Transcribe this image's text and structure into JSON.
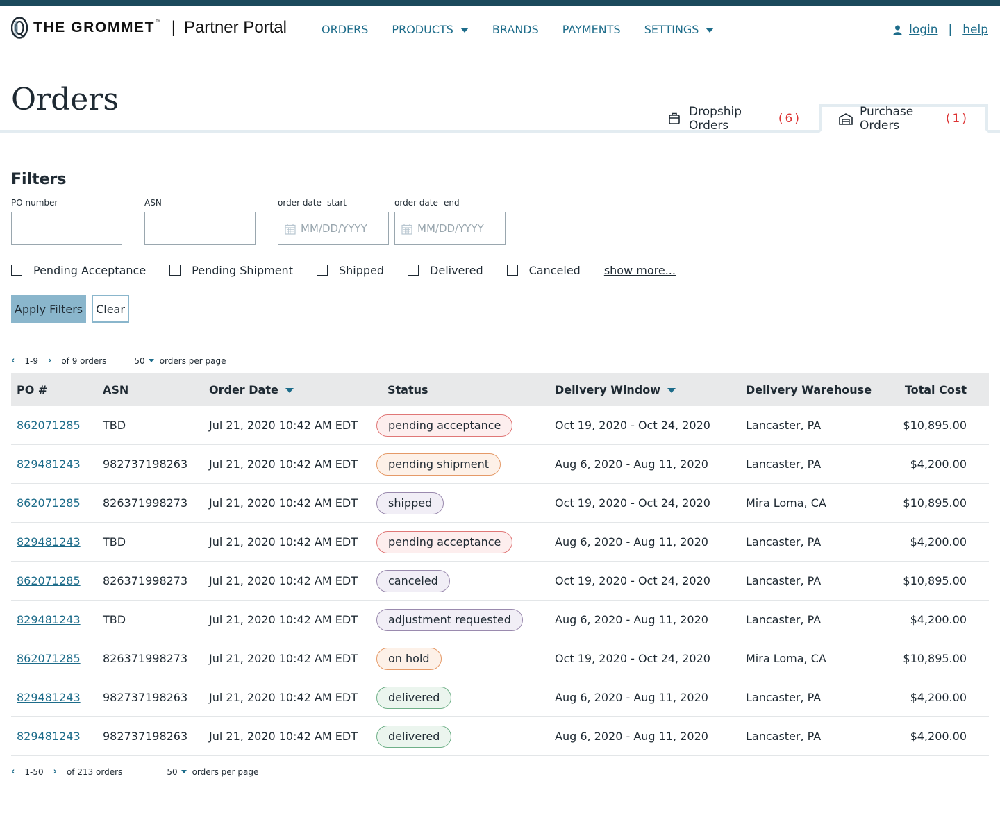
{
  "brand": {
    "name": "THE GROMMET",
    "trademark": "™",
    "separator": "|",
    "portal": "Partner Portal",
    "colors": {
      "topbar": "#1b4a5c",
      "link": "#1d6c8a",
      "accent": "#8ab6cc"
    }
  },
  "nav": {
    "orders": "ORDERS",
    "products": "PRODUCTS",
    "brands": "BRANDS",
    "payments": "PAYMENTS",
    "settings": "SETTINGS"
  },
  "util": {
    "login": "login",
    "separator": "|",
    "help": "help",
    "user_icon": "user-icon"
  },
  "page": {
    "title": "Orders"
  },
  "tabs": {
    "dropship": {
      "label": "Dropship Orders",
      "count": "(6)",
      "icon": "box-icon"
    },
    "purchase": {
      "label": "Purchase Orders",
      "count": "(1)",
      "icon": "warehouse-icon"
    }
  },
  "filters": {
    "title": "Filters",
    "po_label": "PO number",
    "asn_label": "ASN",
    "start_label": "order date- start",
    "end_label": "order date- end",
    "date_placeholder": "MM/DD/YYYY",
    "checkboxes": [
      "Pending Acceptance",
      "Pending Shipment",
      "Shipped",
      "Delivered",
      "Canceled"
    ],
    "show_more": "show more...",
    "apply": "Apply Filters",
    "clear": "Clear"
  },
  "pager_top": {
    "range": "1-9",
    "total": "of 9 orders",
    "per_page": "50",
    "per_page_label": "orders per page"
  },
  "pager_bottom": {
    "range": "1-50",
    "total": "of 213 orders",
    "per_page": "50",
    "per_page_label": "orders per page"
  },
  "table": {
    "headers": {
      "po": "PO #",
      "asn": "ASN",
      "date": "Order Date",
      "status": "Status",
      "window": "Delivery Window",
      "warehouse": "Delivery Warehouse",
      "cost": "Total Cost"
    },
    "status_styles": {
      "pending acceptance": {
        "bg": "#fdeeee",
        "border": "#e07777"
      },
      "pending shipment": {
        "bg": "#fdf1e8",
        "border": "#e59a68"
      },
      "shipped": {
        "bg": "#f1eef6",
        "border": "#9a8aae"
      },
      "canceled": {
        "bg": "#f1eef6",
        "border": "#9a8aae"
      },
      "adjustment requested": {
        "bg": "#f1eef6",
        "border": "#9a8aae"
      },
      "on hold": {
        "bg": "#fdf1e8",
        "border": "#e59a68"
      },
      "delivered": {
        "bg": "#ebf5ee",
        "border": "#6fb088"
      }
    },
    "rows": [
      {
        "po": "862071285",
        "asn": "TBD",
        "date": "Jul 21, 2020 10:42 AM EDT",
        "status": "pending acceptance",
        "window": "Oct 19, 2020 - Oct 24, 2020",
        "warehouse": "Lancaster, PA",
        "cost": "$10,895.00"
      },
      {
        "po": "829481243",
        "asn": "982737198263",
        "date": "Jul 21, 2020 10:42 AM EDT",
        "status": "pending shipment",
        "window": "Aug 6, 2020 - Aug 11, 2020",
        "warehouse": "Lancaster, PA",
        "cost": "$4,200.00"
      },
      {
        "po": "862071285",
        "asn": "826371998273",
        "date": "Jul 21, 2020 10:42 AM EDT",
        "status": "shipped",
        "window": "Oct 19, 2020 - Oct 24, 2020",
        "warehouse": "Mira Loma, CA",
        "cost": "$10,895.00"
      },
      {
        "po": "829481243",
        "asn": "TBD",
        "date": "Jul 21, 2020 10:42 AM EDT",
        "status": "pending acceptance",
        "window": "Aug 6, 2020 - Aug 11, 2020",
        "warehouse": "Lancaster, PA",
        "cost": "$4,200.00"
      },
      {
        "po": "862071285",
        "asn": "826371998273",
        "date": "Jul 21, 2020 10:42 AM EDT",
        "status": "canceled",
        "window": "Oct 19, 2020 - Oct 24, 2020",
        "warehouse": "Lancaster, PA",
        "cost": "$10,895.00"
      },
      {
        "po": "829481243",
        "asn": "TBD",
        "date": "Jul 21, 2020 10:42 AM EDT",
        "status": "adjustment requested",
        "window": "Aug 6, 2020 - Aug 11, 2020",
        "warehouse": "Lancaster, PA",
        "cost": "$4,200.00"
      },
      {
        "po": "862071285",
        "asn": "826371998273",
        "date": "Jul 21, 2020 10:42 AM EDT",
        "status": "on hold",
        "window": "Oct 19, 2020 - Oct 24, 2020",
        "warehouse": "Mira Loma, CA",
        "cost": "$10,895.00"
      },
      {
        "po": "829481243",
        "asn": "982737198263",
        "date": "Jul 21, 2020 10:42 AM EDT",
        "status": "delivered",
        "window": "Aug 6, 2020 - Aug 11, 2020",
        "warehouse": "Lancaster, PA",
        "cost": "$4,200.00"
      },
      {
        "po": "829481243",
        "asn": "982737198263",
        "date": "Jul 21, 2020 10:42 AM EDT",
        "status": "delivered",
        "window": "Aug 6, 2020 - Aug 11, 2020",
        "warehouse": "Lancaster, PA",
        "cost": "$4,200.00"
      }
    ]
  }
}
